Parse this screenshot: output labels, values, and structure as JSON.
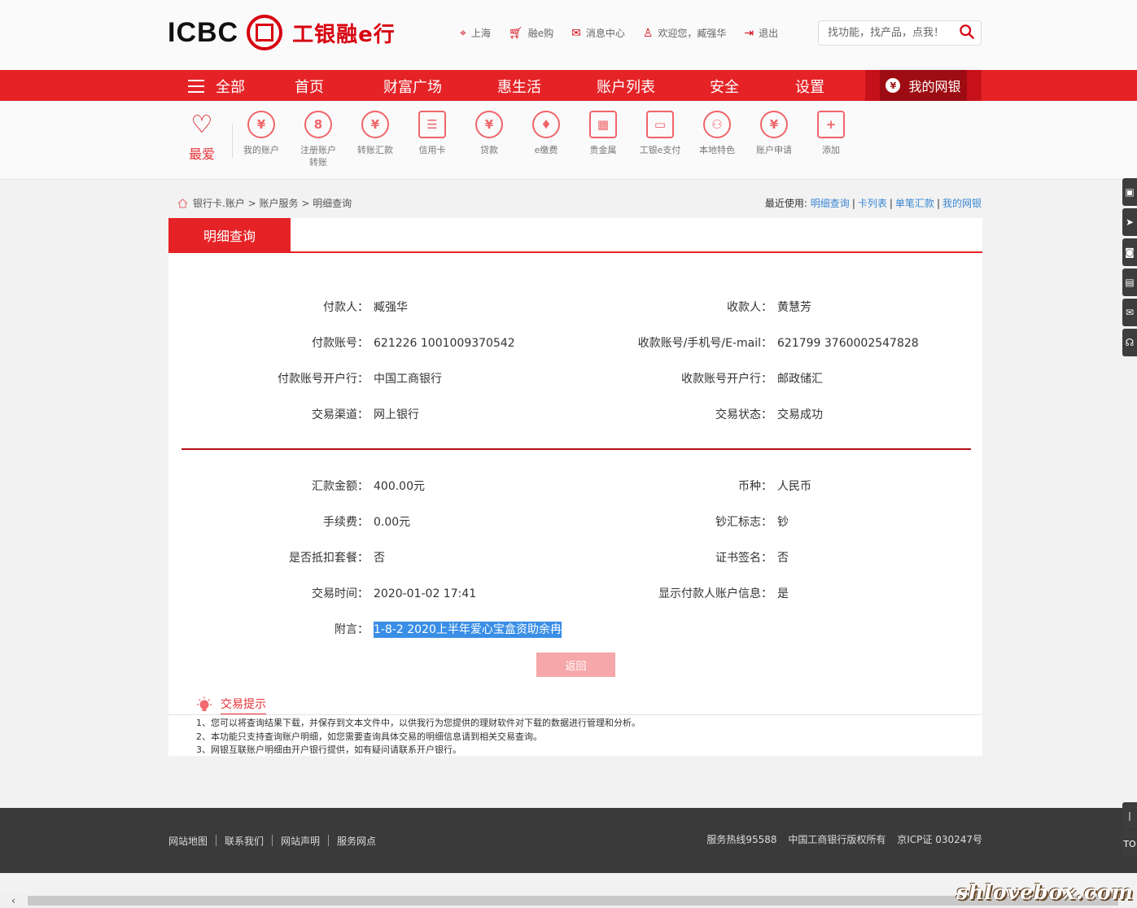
{
  "brand": {
    "logo_text": "ICBC",
    "name_cn": "工银融e行"
  },
  "toplinks": [
    {
      "icon": "location-pin-icon",
      "label": "上海"
    },
    {
      "icon": "cart-icon",
      "label": "融e购"
    },
    {
      "icon": "mail-icon",
      "label": "消息中心"
    },
    {
      "icon": "user-icon",
      "label": "欢迎您，臧强华"
    },
    {
      "icon": "logout-icon",
      "label": "退出"
    }
  ],
  "search": {
    "placeholder": "找功能，找产品，点我！"
  },
  "nav": {
    "all": "全部",
    "items": [
      "首页",
      "财富广场",
      "惠生活",
      "账户列表",
      "安全",
      "设置"
    ],
    "mybank": "我的网银"
  },
  "quick": {
    "fav": "最爱",
    "items": [
      {
        "label": "我的账户",
        "glyph": "¥"
      },
      {
        "label": "注册账户转账",
        "glyph": "8"
      },
      {
        "label": "转账汇款",
        "glyph": "¥"
      },
      {
        "label": "信用卡",
        "glyph": "☰"
      },
      {
        "label": "贷款",
        "glyph": "¥"
      },
      {
        "label": "e缴费",
        "glyph": "♦"
      },
      {
        "label": "贵金属",
        "glyph": "▦"
      },
      {
        "label": "工银e支付",
        "glyph": "▭"
      },
      {
        "label": "本地特色",
        "glyph": "⚇"
      },
      {
        "label": "账户申请",
        "glyph": "¥"
      },
      {
        "label": "添加",
        "glyph": "+"
      }
    ]
  },
  "breadcrumb": {
    "path": "银行卡.账户 > 账户服务 > 明细查询"
  },
  "recent": {
    "label": "最近使用:",
    "links": [
      "明细查询",
      "卡列表",
      "单笔汇款",
      "我的网银"
    ]
  },
  "panel": {
    "tab": "明细查询",
    "section1": [
      {
        "l_label": "付款人：",
        "l_value": "臧强华",
        "r_label": "收款人：",
        "r_value": "黄慧芳"
      },
      {
        "l_label": "付款账号：",
        "l_value": "621226 1001009370542",
        "r_label": "收款账号/手机号/E-mail：",
        "r_value": "621799 3760002547828"
      },
      {
        "l_label": "付款账号开户行：",
        "l_value": "中国工商银行",
        "r_label": "收款账号开户行：",
        "r_value": "邮政储汇"
      },
      {
        "l_label": "交易渠道：",
        "l_value": "网上银行",
        "r_label": "交易状态：",
        "r_value": "交易成功"
      }
    ],
    "section2": [
      {
        "l_label": "汇款金额：",
        "l_value": "400.00元",
        "r_label": "币种：",
        "r_value": "人民币"
      },
      {
        "l_label": "手续费：",
        "l_value": "0.00元",
        "r_label": "钞汇标志：",
        "r_value": "钞"
      },
      {
        "l_label": "是否抵扣套餐：",
        "l_value": "否",
        "r_label": "证书签名：",
        "r_value": "否"
      },
      {
        "l_label": "交易时间：",
        "l_value": "2020-01-02 17:41",
        "r_label": "显示付款人账户信息：",
        "r_value": "是"
      }
    ],
    "memo_label": "附言：",
    "memo_value": "1-8-2 2020上半年爱心宝盒资助余冉",
    "back": "返回"
  },
  "tips": {
    "title": "交易提示",
    "lines": [
      "1、您可以将查询结果下载，并保存到文本文件中，以供我行为您提供的理财软件对下载的数据进行管理和分析。",
      "2、本功能只支持查询账户明细，如您需要查询具体交易的明细信息请到相关交易查询。",
      "3、网银互联账户明细由开户银行提供，如有疑问请联系开户银行。"
    ]
  },
  "footer": {
    "links": [
      "网站地图",
      "联系我们",
      "网站声明",
      "服务网点"
    ],
    "hotline": "服务热线95588",
    "copyright": "中国工商银行版权所有",
    "icp": "京ICP证 030247号"
  },
  "watermark": "shlovebox.com",
  "colors": {
    "brand_red": "#e52327",
    "dark_red": "#9d0c12",
    "link_blue": "#3a87d2"
  }
}
